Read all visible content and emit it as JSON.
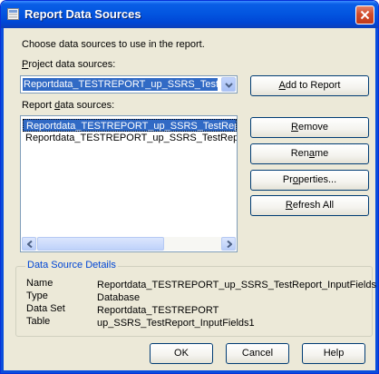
{
  "window": {
    "title": "Report Data Sources"
  },
  "instruction": "Choose data sources to use in the report.",
  "project": {
    "label_pre": "",
    "label_key": "P",
    "label_post": "roject data sources:",
    "selected": "Reportdata_TESTREPORT_up_SSRS_TestRep"
  },
  "report": {
    "label_pre": "Report ",
    "label_key": "d",
    "label_post": "ata sources:",
    "items": [
      "Reportdata_TESTREPORT_up_SSRS_TestReport",
      "Reportdata_TESTREPORT_up_SSRS_TestRepor"
    ]
  },
  "buttons": {
    "add": {
      "pre": "",
      "key": "A",
      "post": "dd to Report"
    },
    "remove": {
      "pre": "",
      "key": "R",
      "post": "emove"
    },
    "rename": {
      "pre": "Ren",
      "key": "a",
      "post": "me"
    },
    "properties": {
      "pre": "Pr",
      "key": "o",
      "post": "perties..."
    },
    "refresh": {
      "pre": "",
      "key": "R",
      "post": "efresh All"
    },
    "ok": "OK",
    "cancel": "Cancel",
    "help": "Help"
  },
  "details": {
    "title": "Data Source Details",
    "rows": [
      {
        "label": "Name",
        "value": "Reportdata_TESTREPORT_up_SSRS_TestReport_InputFields"
      },
      {
        "label": "Type",
        "value": "Database"
      },
      {
        "label": "Data Set",
        "value": "Reportdata_TESTREPORT"
      },
      {
        "label": "Table",
        "value": "up_SSRS_TestReport_InputFields1"
      }
    ]
  },
  "colors": {
    "titlebar": "#0356e0",
    "dialog_bg": "#ece9d8",
    "selection": "#316ac5",
    "group_title": "#0046d5"
  },
  "icons": {
    "title": "data-sources-icon",
    "close": "close-icon",
    "dropdown": "chevron-down-icon",
    "scroll_left": "arrow-left-icon",
    "scroll_right": "arrow-right-icon"
  }
}
